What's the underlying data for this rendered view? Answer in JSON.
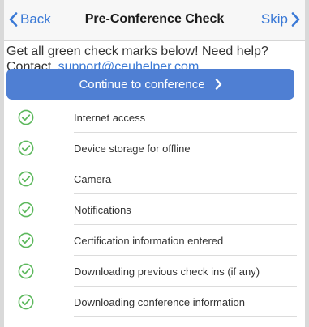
{
  "navbar": {
    "back_label": "Back",
    "title": "Pre-Conference Check",
    "skip_label": "Skip"
  },
  "intro": {
    "text": "Get all green check marks below! Need help?",
    "contact_prefix": "Contact",
    "email": "support@ceuhelper.com"
  },
  "continue_button": {
    "label": "Continue to conference"
  },
  "checks": [
    {
      "label": "Internet access",
      "status": "passed",
      "icon": "check-circle-icon"
    },
    {
      "label": "Device storage for offline",
      "status": "passed",
      "icon": "check-circle-icon"
    },
    {
      "label": "Camera",
      "status": "passed",
      "icon": "check-circle-icon"
    },
    {
      "label": "Notifications",
      "status": "passed",
      "icon": "check-circle-icon"
    },
    {
      "label": "Certification information entered",
      "status": "passed",
      "icon": "check-circle-icon"
    },
    {
      "label": "Downloading previous check ins (if any)",
      "status": "passed",
      "icon": "check-circle-icon"
    },
    {
      "label": "Downloading conference information",
      "status": "passed",
      "icon": "check-circle-icon"
    }
  ],
  "colors": {
    "accent": "#3a79d6",
    "button": "#4f7fd3",
    "check_green": "#5cb85c",
    "text": "#333333"
  }
}
